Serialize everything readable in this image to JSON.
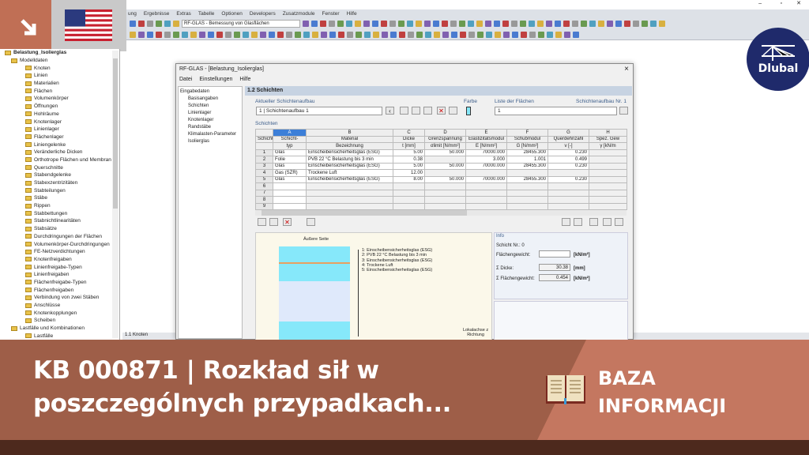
{
  "app": {
    "menu": [
      "ung",
      "Ergebnisse",
      "Extras",
      "Tabelle",
      "Optionen",
      "Developers",
      "Zusatzmodule",
      "Fenster",
      "Hilfe"
    ],
    "module_select": "RF-GLAS - Bemessung von Glasflächen",
    "status_tab": "1.1 Knoten"
  },
  "tree": {
    "root": "Belastung_Isolierglas",
    "group": "Modelldaten",
    "items": [
      "Knoten",
      "Linien",
      "Materialien",
      "Flächen",
      "Volumenkörper",
      "Öffnungen",
      "Hohlräume",
      "Knotenlager",
      "Linienlager",
      "Flächenlager",
      "Liniengelenke",
      "Veränderliche Dicken",
      "Orthotrope Flächen und Membran",
      "Querschnitte",
      "Stabendgelenke",
      "Stabexzentrizitäten",
      "Stabteilungen",
      "Stäbe",
      "Rippen",
      "Stabbettungen",
      "Stabnichtlinearitäten",
      "Stabsätze",
      "Durchdringungen der Flächen",
      "Volumenkörper-Durchdringungen",
      "FE-Netzverdichtungen",
      "Knotenfreigaben",
      "Linienfreigabe-Typen",
      "Linienfreigaben",
      "Flächenfreigabe-Typen",
      "Flächenfreigaben",
      "Verbindung von zwei Stäben",
      "Anschlüsse",
      "Knotenkopplungen",
      "Scheiben"
    ],
    "group2": "Lastfälle und Kombinationen",
    "item2": "Lastfälle"
  },
  "dialog": {
    "title": "RF-GLAS - [Belastung_Isolierglas]",
    "close": "×",
    "menu": [
      "Datei",
      "Einstellungen",
      "Hilfe"
    ],
    "nav_root": "Eingabedaten",
    "nav": [
      "Basisangaben",
      "Schichten",
      "Linienlager",
      "Knotenlager",
      "Randstäbe",
      "Klimalasten-Parameter",
      "Isolierglas"
    ],
    "section": "1.2 Schichten",
    "current_label": "Aktueller Schichtenaufbau",
    "current_value": "1 | Schichtenaufbau 1",
    "farbe": "Farbe",
    "list_label": "Liste der Flächen",
    "list_value": "1",
    "aufbau_nr": "Schichtenaufbau Nr. 1",
    "table_label": "Schichten",
    "col_letters": [
      "A",
      "B",
      "C",
      "D",
      "E",
      "F",
      "G",
      "H"
    ],
    "col_head1": [
      "Schicht Nr.",
      "Schicht-",
      "Material",
      "Dicke",
      "Grenzspannung",
      "Elastizitätsmodul",
      "Schubmodul",
      "Querdehnzahl",
      "Spez. Gew"
    ],
    "col_head2": [
      "",
      "typ",
      "Bezeichnung",
      "t [mm]",
      "σlimit [N/mm²]",
      "E [N/mm²]",
      "G [N/mm²]",
      "ν [-]",
      "γ [kN/m"
    ],
    "rows": [
      [
        "1",
        "Glas",
        "Einscheibensicherheitsglas (ESG)",
        "5.00",
        "50.000",
        "70000.000",
        "28455.300",
        "0.230",
        ""
      ],
      [
        "2",
        "Folie",
        "PVB 22 °C Belastung bis 3 min",
        "0.38",
        "",
        "3.000",
        "1.001",
        "0.499",
        ""
      ],
      [
        "3",
        "Glas",
        "Einscheibensicherheitsglas (ESG)",
        "5.00",
        "50.000",
        "70000.000",
        "28455.300",
        "0.230",
        ""
      ],
      [
        "4",
        "Gas (SZR)",
        "Trockene Luft",
        "12.00",
        "",
        "",
        "",
        "",
        ""
      ],
      [
        "5",
        "Glas",
        "Einscheibensicherheitsglas (ESG)",
        "8.00",
        "50.000",
        "70000.000",
        "28455.300",
        "0.230",
        ""
      ],
      [
        "6",
        "",
        "",
        "",
        "",
        "",
        "",
        "",
        ""
      ],
      [
        "7",
        "",
        "",
        "",
        "",
        "",
        "",
        "",
        ""
      ],
      [
        "8",
        "",
        "",
        "",
        "",
        "",
        "",
        "",
        ""
      ],
      [
        "9",
        "",
        "",
        "",
        "",
        "",
        "",
        "",
        ""
      ]
    ],
    "preview": {
      "top": "Äußere Seite",
      "legend": [
        "1: Einscheibensicherheitsglas (ESG)",
        "2: PVB 22 °C Belastung bis 3 min",
        "3: Einscheibensicherheitsglas (ESG)",
        "4: Trockene Luft",
        "5: Einscheibensicherheitsglas (ESG)"
      ],
      "axis1": "Lokalachse z",
      "axis2": "Richtung"
    },
    "info": {
      "title": "Info",
      "schicht": "Schicht Nr.: 0",
      "fg_label": "Flächengewicht:",
      "fg_unit": "[kN/m²]",
      "dicke_label": "Σ Dicke:",
      "dicke": "30.38",
      "dicke_unit": "[mm]",
      "sfg_label": "Σ Flächengewicht:",
      "sfg": "0.454",
      "sfg_unit": "[kN/m²]"
    }
  },
  "banner": {
    "title": "KB 000871 | Rozkład sił w poszczególnych przypadkach...",
    "category_1": "BAZA",
    "category_2": "INFORMACJI"
  },
  "logo": {
    "text": "Dlubal"
  },
  "colors": {
    "banner": "#9e5e48",
    "banner_right": "#c47760",
    "dlubal": "#1f2a6b",
    "glass": "#86e8fa"
  }
}
